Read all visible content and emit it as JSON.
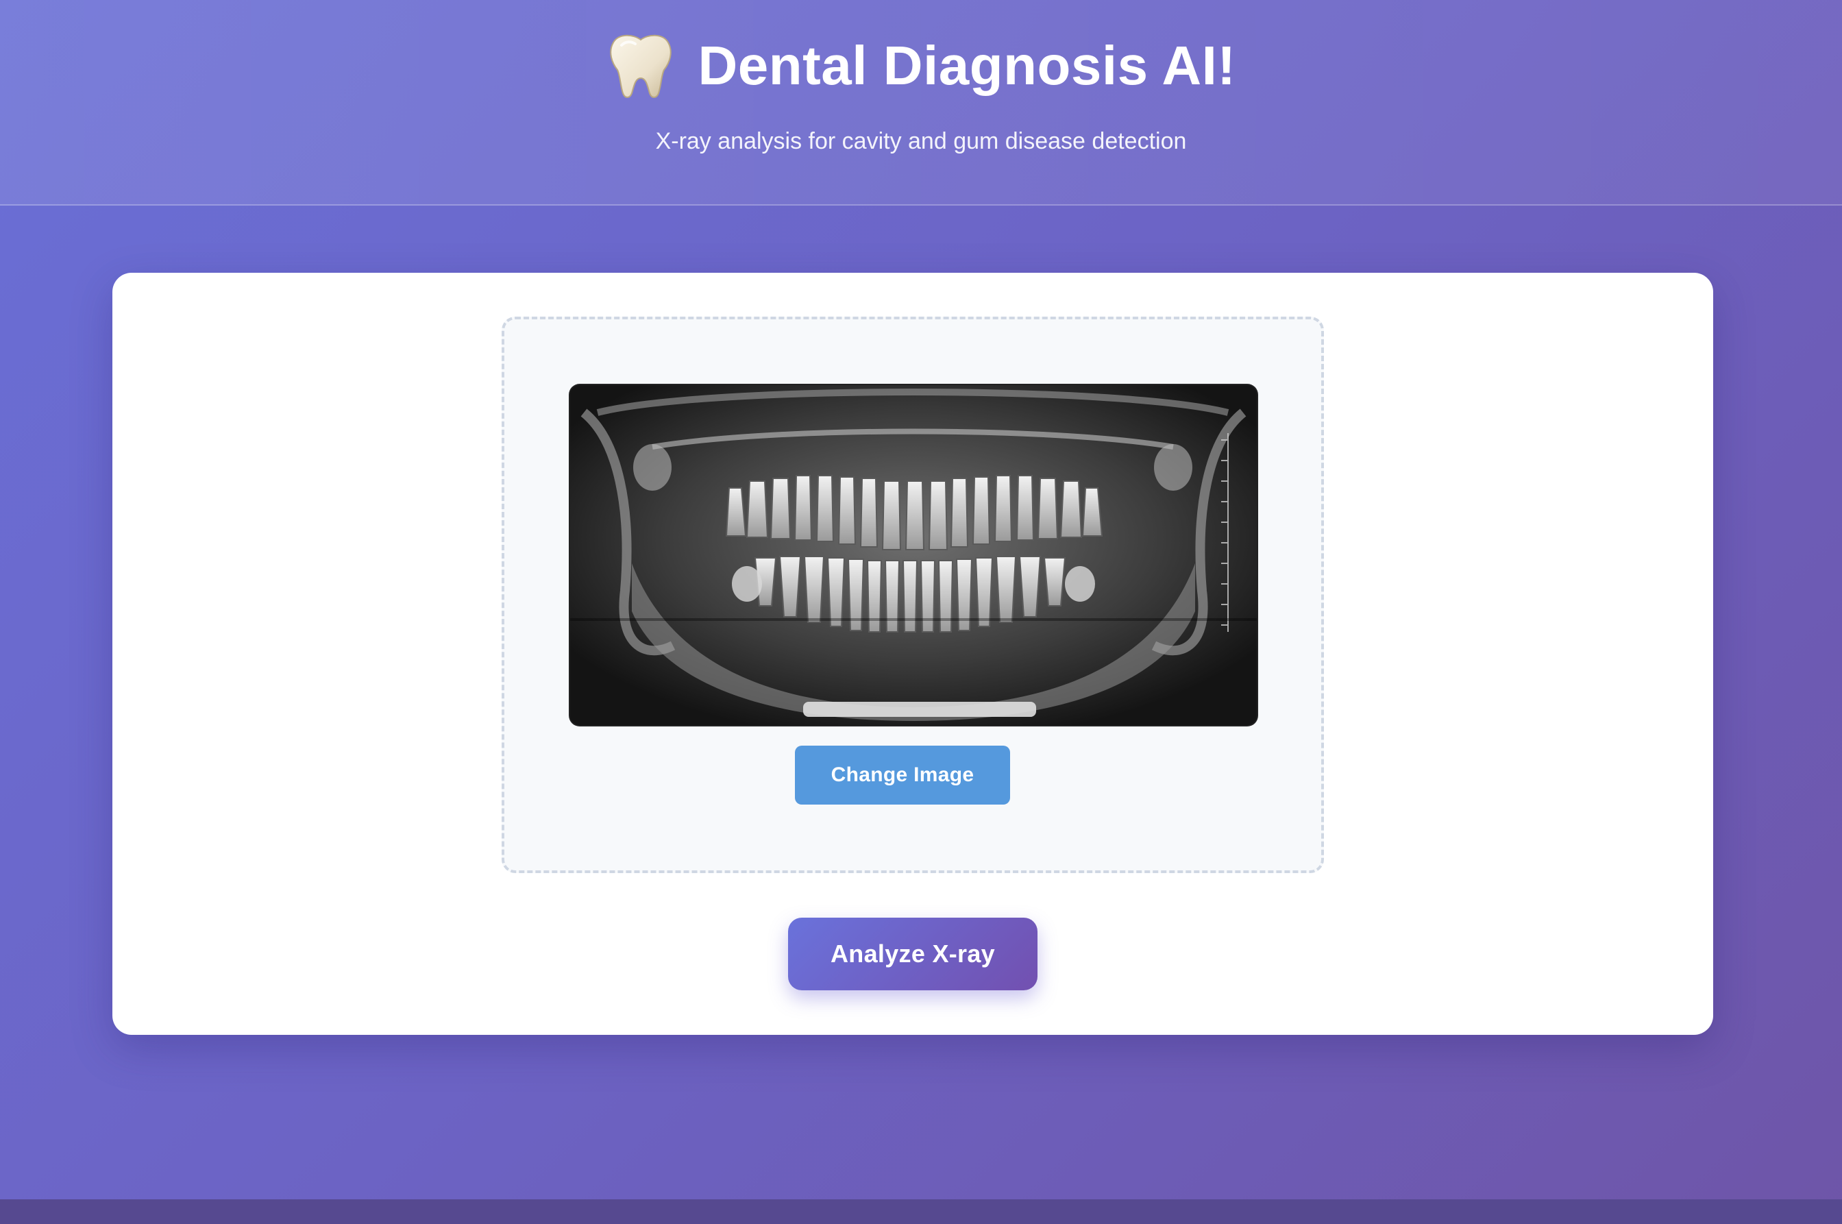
{
  "header": {
    "icon": "tooth-icon",
    "title": "Dental Diagnosis AI!",
    "subtitle": "X-ray analysis for cavity and gum disease detection"
  },
  "upload": {
    "image_alt": "Panoramic dental X-ray",
    "change_button_label": "Change Image"
  },
  "actions": {
    "analyze_button_label": "Analyze X-ray"
  },
  "colors": {
    "background_start": "#6a6fd6",
    "background_end": "#6e55a8",
    "change_button": "#5599dd",
    "analyze_button_start": "#6a72db",
    "analyze_button_end": "#7250b0",
    "card": "#ffffff",
    "upload_zone_bg": "#f7f9fb",
    "upload_zone_border": "#cfd7e3"
  }
}
